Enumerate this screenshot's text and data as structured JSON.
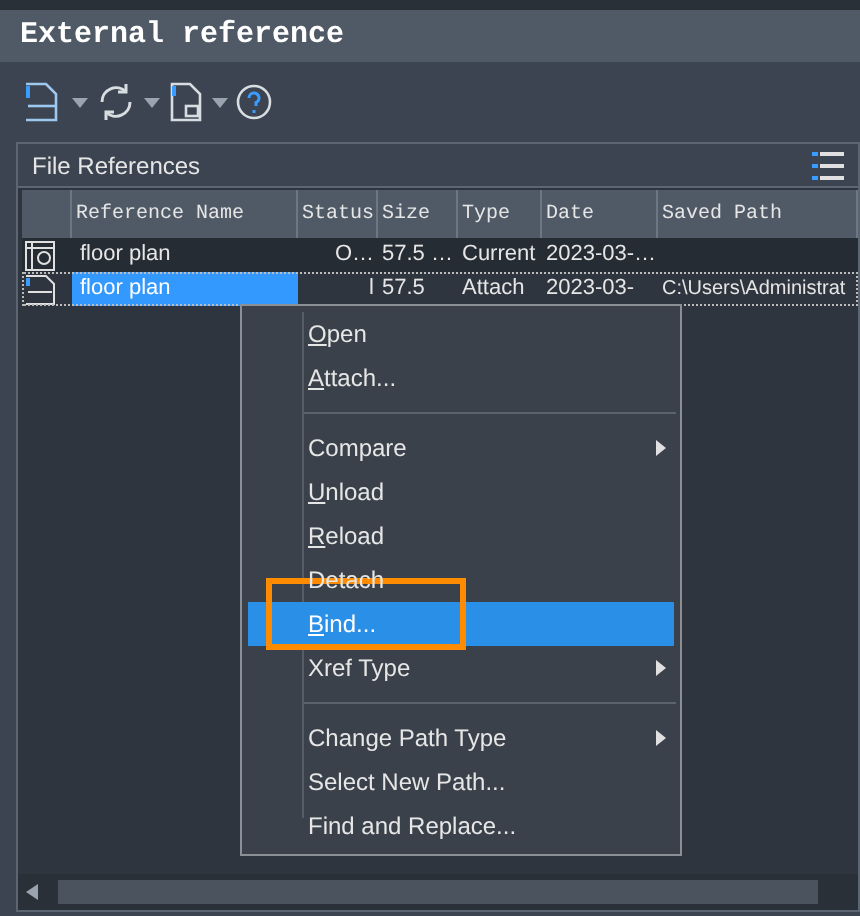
{
  "window": {
    "title": "External reference"
  },
  "panel": {
    "title": "File References"
  },
  "table": {
    "columns": [
      "Reference Name",
      "Status",
      "Size",
      "Type",
      "Date",
      "Saved Path"
    ],
    "rows": [
      {
        "kind": "current",
        "selected": false,
        "cells": [
          "floor plan",
          "O…",
          "57.5 …",
          "Current",
          "2023-03-…",
          ""
        ]
      },
      {
        "kind": "dwg",
        "selected": true,
        "cells": [
          "floor plan",
          "l",
          "57.5",
          "Attach",
          "2023-03-",
          "C:\\Users\\Administrat"
        ]
      }
    ]
  },
  "context_menu": {
    "items": [
      {
        "kind": "item",
        "label": "Open",
        "mnemonic": true,
        "submenu": false,
        "selected": false
      },
      {
        "kind": "item",
        "label": "Attach...",
        "mnemonic": true,
        "submenu": false,
        "selected": false
      },
      {
        "kind": "separator"
      },
      {
        "kind": "item",
        "label": "Compare",
        "mnemonic": false,
        "submenu": true,
        "selected": false
      },
      {
        "kind": "item",
        "label": "Unload",
        "mnemonic": true,
        "submenu": false,
        "selected": false
      },
      {
        "kind": "item",
        "label": "Reload",
        "mnemonic": true,
        "submenu": false,
        "selected": false
      },
      {
        "kind": "item",
        "label": "Detach",
        "mnemonic": false,
        "submenu": false,
        "selected": false
      },
      {
        "kind": "item",
        "label": "Bind...",
        "mnemonic": true,
        "submenu": false,
        "selected": true
      },
      {
        "kind": "item",
        "label": "Xref Type",
        "mnemonic": false,
        "submenu": true,
        "selected": false
      },
      {
        "kind": "separator"
      },
      {
        "kind": "item",
        "label": "Change Path Type",
        "mnemonic": false,
        "submenu": true,
        "selected": false
      },
      {
        "kind": "item",
        "label": "Select New Path...",
        "mnemonic": false,
        "submenu": false,
        "selected": false
      },
      {
        "kind": "item",
        "label": "Find and Replace...",
        "mnemonic": false,
        "submenu": false,
        "selected": false
      }
    ]
  }
}
